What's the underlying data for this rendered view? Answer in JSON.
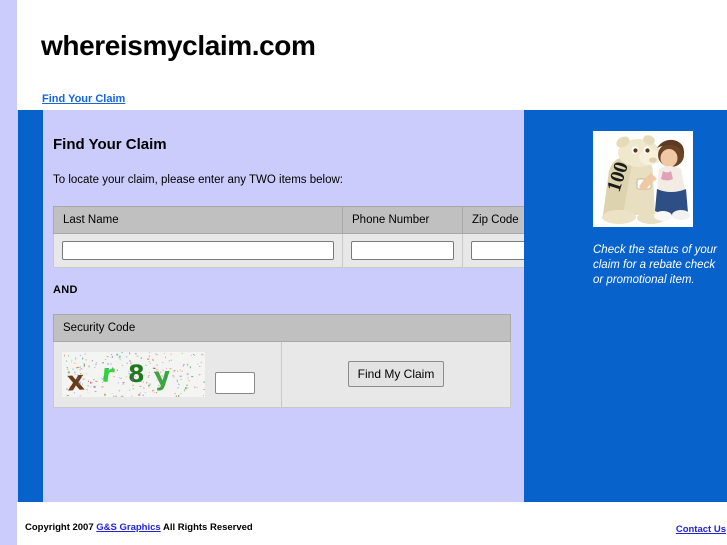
{
  "site": {
    "title": "whereismyclaim.com",
    "accent_blue": "#0862cc",
    "panel_lavender": "#ccccfc",
    "link_blue": "#1565e0"
  },
  "nav": {
    "items": [
      {
        "label": "Find Your Claim"
      }
    ]
  },
  "form": {
    "heading": "Find Your Claim",
    "instructions": "To locate your claim, please enter any TWO items below:",
    "and_label": "AND",
    "fields": [
      {
        "header": "Last Name",
        "value": "",
        "placeholder": ""
      },
      {
        "header": "Phone Number",
        "value": "",
        "placeholder": ""
      },
      {
        "header": "Zip Code",
        "value": "",
        "placeholder": ""
      }
    ],
    "security": {
      "header": "Security Code",
      "captcha_text": "xr8y",
      "captcha_chars": [
        "x",
        "r",
        "8",
        "y"
      ],
      "captcha_colors": [
        "#6b3b17",
        "#2fd63a",
        "#1f7a1f",
        "#3aa83a"
      ],
      "input_value": "",
      "submit_label": "Find My Claim"
    }
  },
  "promo": {
    "image_alt": "child-hugging-plush-camel-photo",
    "image_number": "100",
    "caption": "Check the status of your claim for a rebate check or promotional item."
  },
  "footer": {
    "copyright_prefix": "Copyright 2007 ",
    "company_link": "G&S Graphics",
    "copyright_suffix": " All Rights Reserved",
    "contact_link": "Contact Us"
  }
}
